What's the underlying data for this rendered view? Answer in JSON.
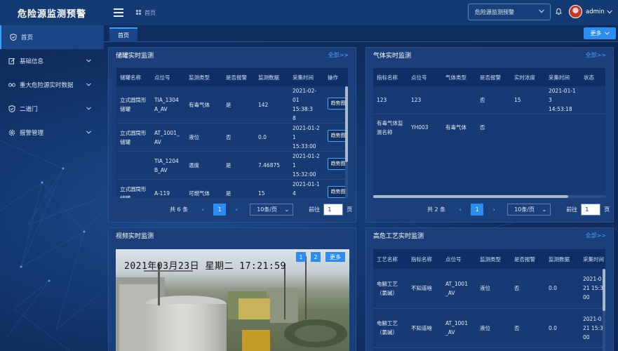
{
  "app": {
    "title": "危险源监测预警"
  },
  "sidebar": {
    "items": [
      {
        "label": "首页",
        "icon": "shield-icon",
        "active": true
      },
      {
        "label": "基础信息",
        "icon": "edit-icon"
      },
      {
        "label": "重大危险源实时数据",
        "icon": "glasses-icon"
      },
      {
        "label": "二道门",
        "icon": "shield-icon"
      },
      {
        "label": "报警管理",
        "icon": "gear-icon"
      }
    ]
  },
  "topbar": {
    "breadcrumb": "首页",
    "selector": "危险源监测预警",
    "user": "admin"
  },
  "tabs": {
    "home": "首页",
    "more": "更多"
  },
  "tank_panel": {
    "title": "储罐实时监测",
    "link": "全部>>",
    "columns": [
      "储罐名称",
      "点位号",
      "监测类型",
      "是否报警",
      "监测数据",
      "采集时间",
      "操作"
    ],
    "rows": [
      {
        "name": [
          "立式圆筒形",
          "储罐"
        ],
        "point": [
          "TIA_1304",
          "A_AV"
        ],
        "type": "有毒气体",
        "alarm": "是",
        "value": "142",
        "time": [
          "2021-02-",
          "01 15:38:3",
          "8"
        ],
        "action": "趋势图"
      },
      {
        "name": [
          "立式圆筒形",
          "储罐"
        ],
        "point": [
          "AT_1001_",
          "AV"
        ],
        "type": "液位",
        "alarm": "否",
        "value": "0.0",
        "time": [
          "2021-01-2",
          "1 15:33:00"
        ],
        "action": "趋势图"
      },
      {
        "name": [
          "",
          ""
        ],
        "point": [
          "TIA_1204",
          "B_AV"
        ],
        "type": "温度",
        "alarm": "是",
        "value": "7.46875",
        "time": [
          "2021-01-2",
          "1 15:32:00"
        ],
        "action": "趋势图"
      },
      {
        "name": [
          "立式圆筒形",
          "储罐"
        ],
        "point": [
          "A-119",
          ""
        ],
        "type": "可燃气体",
        "alarm": "是",
        "value": "15",
        "time": [
          "2021-01-1",
          "4 14:53:18"
        ],
        "action": "趋势图"
      }
    ],
    "pager": {
      "total": "共 6 条",
      "page": "1",
      "size": "10条/页",
      "goto_label": "前往",
      "goto_value": "1",
      "suffix": "页"
    }
  },
  "gas_panel": {
    "title": "气体实时监测",
    "link": "全部>>",
    "columns": [
      "指标名称",
      "点位号",
      "气体类型",
      "是否报警",
      "实时浓度",
      "采集时间",
      "状态"
    ],
    "rows": [
      {
        "name": [
          "123",
          ""
        ],
        "point": "123",
        "type": "",
        "alarm": "否",
        "value": "15",
        "time": [
          "2021-01-1",
          "3 14:53:18"
        ],
        "status": ""
      },
      {
        "name": [
          "有毒气体监",
          "测名称"
        ],
        "point": "YH003",
        "type": "有毒气体",
        "alarm": "否",
        "value": "",
        "time": [
          "",
          ""
        ],
        "status": ""
      }
    ],
    "pager": {
      "total": "共 2 条",
      "page": "1",
      "size": "10条/页",
      "goto_label": "前往",
      "goto_value": "1",
      "suffix": "页"
    }
  },
  "video_panel": {
    "title": "视频实时监测",
    "timestamp": "2021年03月23日  星期二  17:21:59",
    "buttons": [
      "1",
      "2",
      "更多"
    ]
  },
  "process_panel": {
    "title": "高危工艺实时监测",
    "link": "全部>>",
    "columns": [
      "工艺名称",
      "指标名称",
      "点位号",
      "监测类型",
      "是否报警",
      "监测数据",
      "采集时间"
    ],
    "rows": [
      {
        "name": [
          "电解工艺",
          "（氯碱）"
        ],
        "indicator": "不知道啥",
        "point": [
          "AT_1001",
          "_AV"
        ],
        "type": "液位",
        "alarm": "否",
        "value": "0.0",
        "time": [
          "2021-0",
          "21 15:3",
          "00"
        ]
      },
      {
        "name": [
          "电解工艺",
          "（氯碱）"
        ],
        "indicator": "不知道啥",
        "point": [
          "AT_1001",
          "_AV"
        ],
        "type": "液位",
        "alarm": "否",
        "value": "0.0",
        "time": [
          "2021-0",
          "21 15:3",
          "00"
        ]
      }
    ]
  },
  "colors": {
    "accent": "#2d8cf0",
    "link": "#48a6ff",
    "panel": "#1a3f7a",
    "header": "#143a74"
  }
}
